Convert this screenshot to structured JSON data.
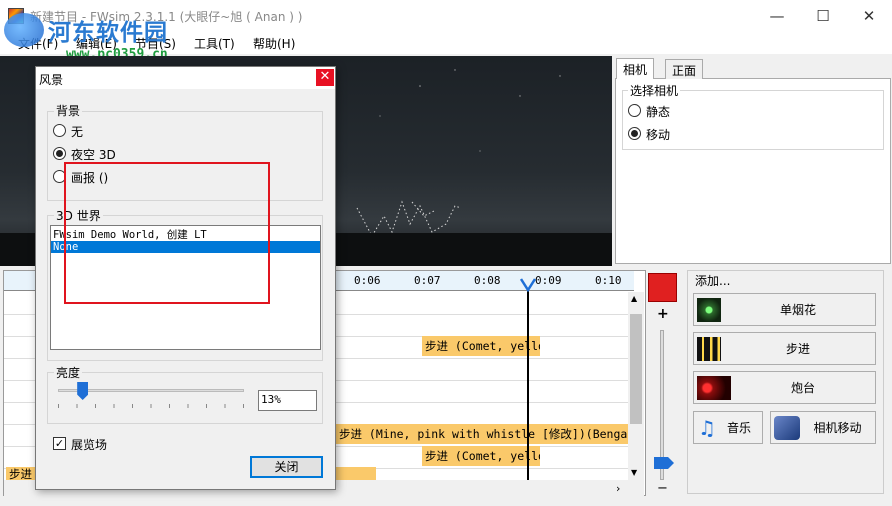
{
  "window": {
    "title": "新建节目 - FWsim 2.3.1.1 (大眼仔~旭 ( Anan ) )",
    "minimize_glyph": "—",
    "maximize_glyph": "☐",
    "close_glyph": "✕"
  },
  "watermark": {
    "name": "河东软件园",
    "url": "www.pc0359.cn"
  },
  "menu": [
    "文件(F)",
    "编辑(E)",
    "节目(S)",
    "工具(T)",
    "帮助(H)"
  ],
  "camera_panel": {
    "tabs": [
      "相机",
      "正面"
    ],
    "group_title": "选择相机",
    "options": [
      {
        "label": "静态",
        "checked": false
      },
      {
        "label": "移动",
        "checked": true
      }
    ]
  },
  "timeline": {
    "ticks": [
      "0:06",
      "0:07",
      "0:08",
      "0:09",
      "0:10"
    ],
    "events": [
      "步进 (Comet, yellow",
      "步进 (Mine, pink with whistle [修改])(Bengal fla",
      "步进 (Comet, yellow",
      "步进"
    ]
  },
  "right_controls": {
    "plus": "+",
    "minus": "−"
  },
  "add_panel": {
    "title": "添加...",
    "buttons": [
      "单烟花",
      "步进",
      "炮台",
      "音乐",
      "相机移动"
    ]
  },
  "dialog": {
    "title": "风景",
    "close": "✕",
    "background_group": "背景",
    "background_options": [
      {
        "label": "无",
        "checked": false
      },
      {
        "label": "夜空 3D",
        "checked": true
      },
      {
        "label": "画报 ()",
        "checked": false
      }
    ],
    "world_group": "3D 世界",
    "world_items": [
      {
        "label": "FWsim Demo World, 创建 LT",
        "selected": false
      },
      {
        "label": "None",
        "selected": true
      }
    ],
    "brightness_group": "亮度",
    "brightness_value": "13%",
    "brightness_level": 0.13,
    "showground_label": "展览场",
    "showground_checked": true,
    "close_button": "关闭"
  },
  "colors": {
    "accent": "#0078d7",
    "event_bar": "#fac96a",
    "record": "#e02020",
    "annotation": "#e0141e"
  }
}
